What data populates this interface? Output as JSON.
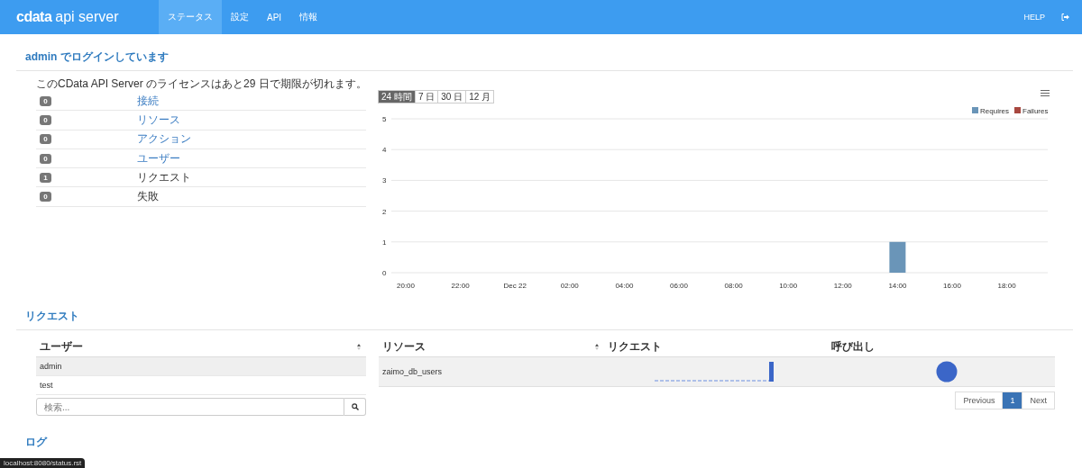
{
  "navbar": {
    "logo_brand": "cdata",
    "logo_product": "api server",
    "items": [
      {
        "label": "ステータス",
        "selected": true
      },
      {
        "label": "設定",
        "selected": false
      },
      {
        "label": "API",
        "selected": false
      },
      {
        "label": "情報",
        "selected": false
      }
    ],
    "help": "HELP"
  },
  "login_heading": "admin でログインしています",
  "license_note": "このCData API Server のライセンスはあと29 日で期限が切れます。",
  "stats": [
    {
      "count": "0",
      "label": "接続",
      "kind": "link"
    },
    {
      "count": "0",
      "label": "リソース",
      "kind": "link"
    },
    {
      "count": "0",
      "label": "アクション",
      "kind": "link"
    },
    {
      "count": "0",
      "label": "ユーザー",
      "kind": "link"
    },
    {
      "count": "1",
      "label": "リクエスト",
      "kind": "text"
    },
    {
      "count": "0",
      "label": "失敗",
      "kind": "text"
    }
  ],
  "range_buttons": [
    {
      "label": "24 時間",
      "selected": true
    },
    {
      "label": "7 日",
      "selected": false
    },
    {
      "label": "30 日",
      "selected": false
    },
    {
      "label": "12 月",
      "selected": false
    }
  ],
  "chart_data": {
    "type": "bar",
    "grid": true,
    "categories": [
      "20:00",
      "22:00",
      "Dec 22",
      "02:00",
      "04:00",
      "06:00",
      "08:00",
      "10:00",
      "12:00",
      "14:00",
      "16:00",
      "18:00"
    ],
    "ylim": [
      0,
      5
    ],
    "yticks": [
      0,
      1,
      2,
      3,
      4,
      5
    ],
    "series": [
      {
        "name": "Requires",
        "color": "#6a95b8",
        "values": [
          0,
          0,
          0,
          0,
          0,
          0,
          0,
          0,
          0,
          1,
          0,
          0
        ]
      },
      {
        "name": "Failures",
        "color": "#a84840",
        "values": [
          0,
          0,
          0,
          0,
          0,
          0,
          0,
          0,
          0,
          0,
          0,
          0
        ]
      }
    ]
  },
  "requests_heading": "リクエスト",
  "users_table": {
    "column": "ユーザー",
    "rows": [
      {
        "name": "admin",
        "selected": true
      },
      {
        "name": "test",
        "selected": false
      }
    ],
    "search_placeholder": "検索..."
  },
  "resources_table": {
    "columns": [
      "リソース",
      "リクエスト",
      "呼び出し"
    ],
    "rows": [
      {
        "resource": "zaimo_db_users"
      }
    ]
  },
  "pagination": {
    "previous": "Previous",
    "pages": [
      {
        "label": "1",
        "selected": true
      }
    ],
    "next": "Next"
  },
  "log_heading": "ログ",
  "status_bar": "localhost:8080/status.rst"
}
